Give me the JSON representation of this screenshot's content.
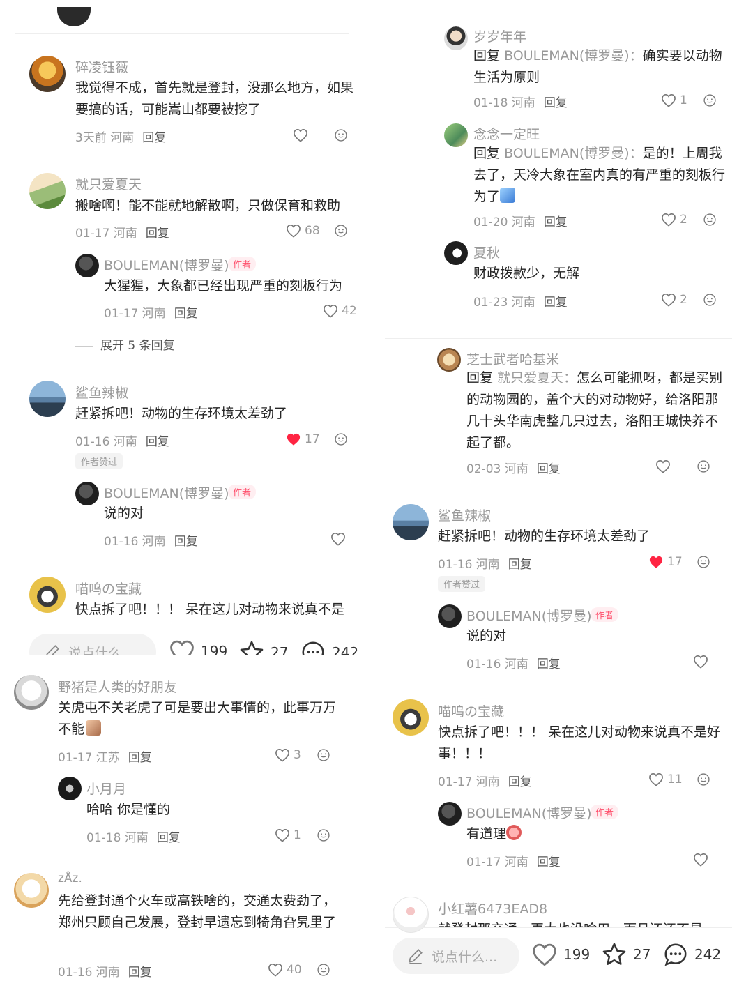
{
  "left_panel_top": {
    "comments": [
      {
        "user": "碎凌钰薇",
        "text": "我觉得不成，首先就是登封，没那么地方，如果要搞的话，可能嵩山都要被挖了",
        "time": "3天前 河南",
        "reply": "回复",
        "likes": ""
      },
      {
        "user": "就只爱夏天",
        "text": "搬啥啊！能不能就地解散啊，只做保育和救助",
        "time": "01-17 河南",
        "reply": "回复",
        "likes": "68",
        "sub": {
          "user": "BOULEMAN(博罗曼)",
          "tag": "作者",
          "text": "大猩猩，大象都已经出现严重的刻板行为",
          "time": "01-17 河南",
          "reply": "回复",
          "likes": "42"
        },
        "expand": "展开 5 条回复"
      },
      {
        "user": "鲨鱼辣椒",
        "text": "赶紧拆吧！动物的生存环境太差劲了",
        "time": "01-16 河南",
        "reply": "回复",
        "likes": "17",
        "badge": "作者赞过",
        "sub": {
          "user": "BOULEMAN(博罗曼)",
          "tag": "作者",
          "text": "说的对",
          "time": "01-16 河南",
          "reply": "回复",
          "likes": ""
        }
      },
      {
        "user": "喵呜の宝藏",
        "text": "快点拆了吧！！！ 呆在这儿对动物来说真不是"
      }
    ],
    "bar": {
      "placeholder": "说点什么...",
      "likes": "199",
      "stars": "27",
      "comments": "242"
    }
  },
  "left_panel_bottom": {
    "comments": [
      {
        "user": "野猪是人类的好朋友",
        "text": "关虎屯不关老虎了可是要出大事情的，此事万万不能",
        "time": "01-17 江苏",
        "reply": "回复",
        "likes": "3",
        "sub": {
          "user": "小月月",
          "text": "哈哈 你是懂的",
          "time": "01-18 河南",
          "reply": "回复",
          "likes": "1"
        }
      },
      {
        "user": "zÅz.",
        "text": "先给登封通个火车或高铁啥的，交通太费劲了，郑州只顾自己发展，登封早遗忘到犄角旮旯里了",
        "time": "01-16 河南",
        "reply": "回复",
        "likes": "40"
      }
    ]
  },
  "right_panel": {
    "replies": [
      {
        "user": "岁岁年年",
        "reply_prefix": "回复",
        "reply_to": "BOULEMAN(博罗曼)：",
        "text": "确实要以动物生活为原则",
        "time": "01-18 河南",
        "reply": "回复",
        "likes": "1"
      },
      {
        "user": "念念一定旺",
        "reply_prefix": "回复",
        "reply_to": "BOULEMAN(博罗曼)：",
        "text": "是的！上周我去了，天冷大象在室内真的有严重的刻板行为了",
        "time": "01-20 河南",
        "reply": "回复",
        "likes": "2"
      },
      {
        "user": "夏秋",
        "text": "财政拨款少，无解",
        "time": "01-23 河南",
        "reply": "回复",
        "likes": "2"
      }
    ],
    "comments": [
      {
        "user": "芝士武者哈基米",
        "reply_prefix": "回复",
        "reply_to": "就只爱夏天：",
        "text": "怎么可能抓呀，都是买别的动物园的，盖个大的对动物好，给洛阳那几十头华南虎整几只过去，洛阳王城快养不起了都。",
        "time": "02-03 河南",
        "reply": "回复",
        "likes": ""
      },
      {
        "user": "鲨鱼辣椒",
        "text": "赶紧拆吧！动物的生存环境太差劲了",
        "time": "01-16 河南",
        "reply": "回复",
        "likes": "17",
        "badge": "作者赞过",
        "sub": {
          "user": "BOULEMAN(博罗曼)",
          "tag": "作者",
          "text": "说的对",
          "time": "01-16 河南",
          "reply": "回复",
          "likes": ""
        }
      },
      {
        "user": "喵呜の宝藏",
        "text": "快点拆了吧！！！ 呆在这儿对动物来说真不是好事！！！",
        "time": "01-17 河南",
        "reply": "回复",
        "likes": "11",
        "sub": {
          "user": "BOULEMAN(博罗曼)",
          "tag": "作者",
          "text": "有道理",
          "time": "01-17 河南",
          "reply": "回复",
          "likes": ""
        }
      },
      {
        "user": "小红薯6473EAD8",
        "text": "就登封那交通，再大也没啥用，而且还还不是"
      }
    ],
    "bar": {
      "placeholder": "说点什么...",
      "likes": "199",
      "stars": "27",
      "comments": "242"
    }
  },
  "colors": {
    "liked_heart": "#ff2442",
    "author_tag": "#ff4d6a",
    "muted": "#999999"
  }
}
